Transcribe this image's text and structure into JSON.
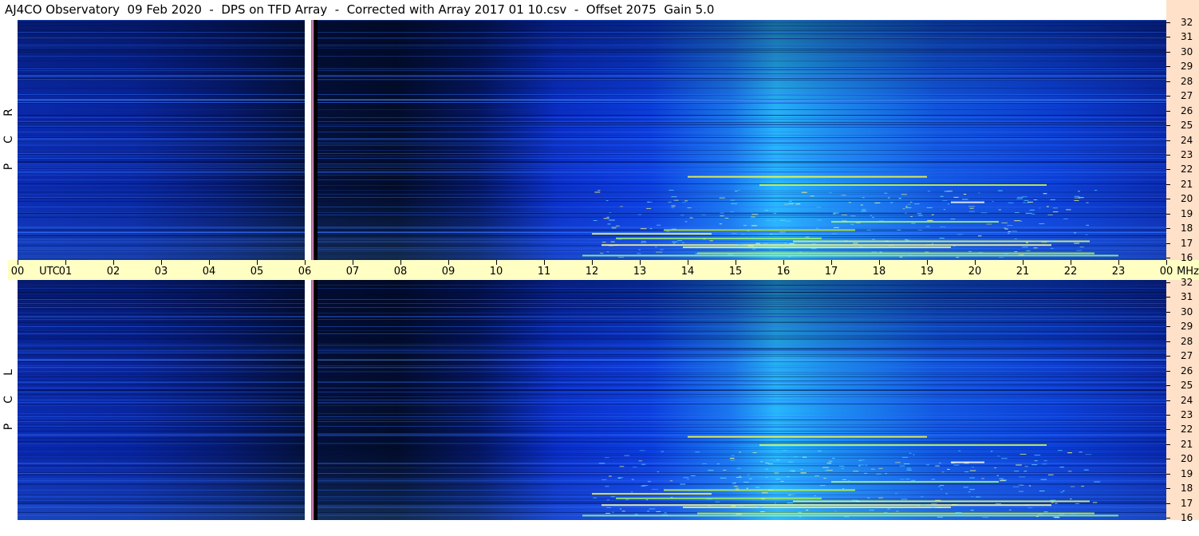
{
  "title": "AJ4CO Observatory  09 Feb 2020  -  DPS on TFD Array  -  Corrected with Array 2017 01 10.csv  -  Offset 2075  Gain 5.0",
  "chart_data": {
    "type": "heatmap",
    "x_axis": {
      "range": [
        0,
        24
      ],
      "ticks": [
        "00",
        "01",
        "02",
        "03",
        "04",
        "05",
        "06",
        "07",
        "08",
        "09",
        "10",
        "11",
        "12",
        "13",
        "14",
        "15",
        "16",
        "17",
        "18",
        "19",
        "20",
        "21",
        "22",
        "23",
        "00"
      ],
      "label": "UTC"
    },
    "y_axis": {
      "range": [
        16,
        32
      ],
      "ticks": [
        "16",
        "17",
        "18",
        "19",
        "20",
        "21",
        "22",
        "23",
        "24",
        "25",
        "26",
        "27",
        "28",
        "29",
        "30",
        "31",
        "32"
      ],
      "label": "MHz"
    },
    "panels": [
      {
        "name": "RCP",
        "label_letters": [
          "R",
          "C",
          "P"
        ]
      },
      {
        "name": "LCP",
        "label_letters": [
          "L",
          "C",
          "P"
        ]
      }
    ],
    "colors": {
      "low": "#000820",
      "mid": "#0a3cd8",
      "high": "#22d0ff",
      "burst": "#ffff40",
      "axis_bg": "#ffffc4",
      "right_bg": "#ffe0c8"
    }
  }
}
